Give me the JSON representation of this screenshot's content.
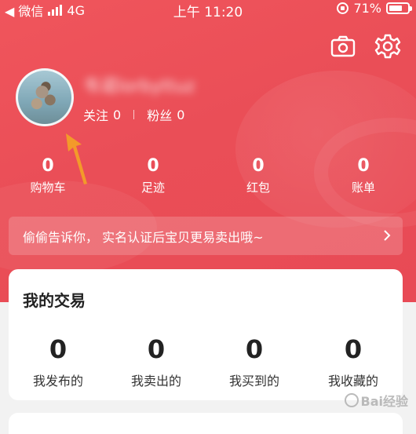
{
  "status_bar": {
    "back_label": "◀ 微信",
    "network": "4G",
    "time": "上午 11:20",
    "battery": "71%",
    "battery_level": 0.71
  },
  "profile": {
    "username_blurred": "韦诺lorbyttuz",
    "follow_label": "关注",
    "follow_count": "0",
    "fans_label": "粉丝",
    "fans_count": "0"
  },
  "stats": [
    {
      "value": "0",
      "label": "购物车"
    },
    {
      "value": "0",
      "label": "足迹"
    },
    {
      "value": "0",
      "label": "红包"
    },
    {
      "value": "0",
      "label": "账单"
    }
  ],
  "banner": {
    "text": "偷偷告诉你， 实名认证后宝贝更易卖出哦~"
  },
  "trade": {
    "title": "我的交易",
    "items": [
      {
        "value": "0",
        "label": "我发布的"
      },
      {
        "value": "0",
        "label": "我卖出的"
      },
      {
        "value": "0",
        "label": "我买到的"
      },
      {
        "value": "0",
        "label": "我收藏的"
      }
    ]
  },
  "watermark": "Bai经验",
  "icons": {
    "camera": "camera-icon",
    "settings": "gear-icon",
    "arrow": "pointer-arrow-icon",
    "chevron": "chevron-right-icon"
  },
  "colors": {
    "header": "#ea4e57",
    "annotation_arrow": "#f39a2a"
  }
}
